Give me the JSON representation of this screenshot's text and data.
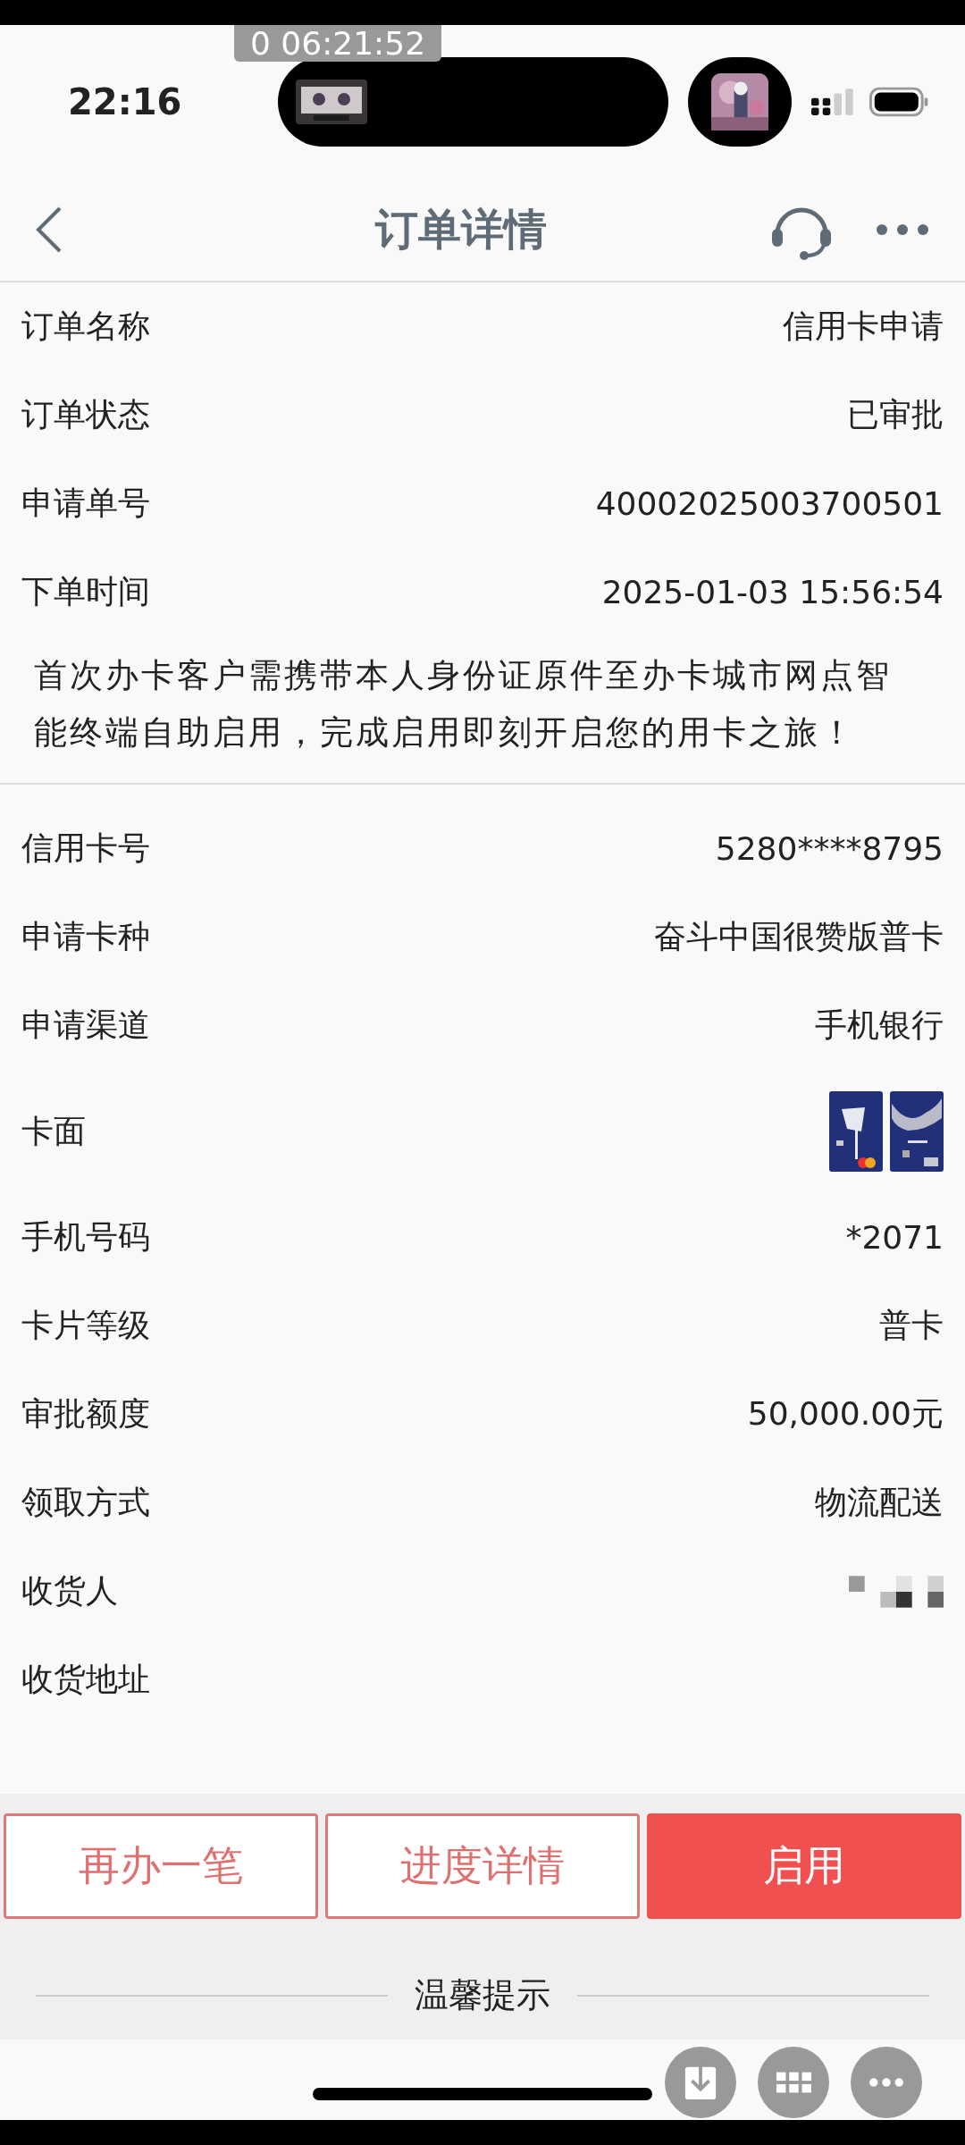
{
  "status_bar": {
    "time": "22:16",
    "recording_timer": "0 06:21:52"
  },
  "nav": {
    "title": "订单详情"
  },
  "order_section": {
    "rows": [
      {
        "kind": "text",
        "label": "订单名称",
        "value": "信用卡申请"
      },
      {
        "kind": "text",
        "label": "订单状态",
        "value": "已审批"
      },
      {
        "kind": "text",
        "label": "申请单号",
        "value": "40002025003700501"
      },
      {
        "kind": "text",
        "label": "下单时间",
        "value": "2025-01-03 15:56:54"
      }
    ]
  },
  "notice": "首次办卡客户需携带本人身份证原件至办卡城市网点智能终端自助启用，完成启用即刻开启您的用卡之旅！",
  "card_section": {
    "rows": [
      {
        "kind": "text",
        "label": "信用卡号",
        "value": "5280****8795"
      },
      {
        "kind": "text",
        "label": "申请卡种",
        "value": "奋斗中国很赞版普卡"
      },
      {
        "kind": "text",
        "label": "申请渠道",
        "value": "手机银行"
      },
      {
        "kind": "card_images",
        "label": "卡面"
      },
      {
        "kind": "masked",
        "label": "手机号码",
        "value": "*2071"
      },
      {
        "kind": "text",
        "label": "卡片等级",
        "value": "普卡"
      },
      {
        "kind": "text",
        "label": "审批额度",
        "value": "50,000.00元"
      },
      {
        "kind": "text",
        "label": "领取方式",
        "value": "物流配送"
      },
      {
        "kind": "redacted",
        "label": "收货人"
      },
      {
        "kind": "empty",
        "label": "收货地址"
      }
    ]
  },
  "actions": [
    {
      "label": "再办一笔",
      "kind": "outline"
    },
    {
      "label": "进度详情",
      "kind": "outline"
    },
    {
      "label": "启用",
      "kind": "filled"
    }
  ],
  "tips_heading": "温馨提示"
}
